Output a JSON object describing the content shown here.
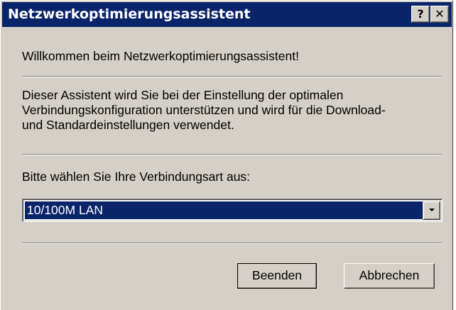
{
  "window": {
    "title": "Netzwerkoptimierungsassistent",
    "help_label": "?",
    "close_label": "✕"
  },
  "content": {
    "welcome": "Willkommen beim Netzwerkoptimierungsassistent!",
    "description_lines": [
      "Dieser Assistent wird Sie bei der Einstellung der optimalen",
      "Verbindungskonfiguration unterstützen und wird für die Download-",
      "und Standardeinstellungen verwendet."
    ],
    "prompt": "Bitte wählen Sie Ihre Verbindungsart aus:"
  },
  "connection_select": {
    "selected": "10/100M LAN",
    "arrow_icon": "chevron-down-icon"
  },
  "buttons": {
    "finish": "Beenden",
    "cancel": "Abbrechen"
  },
  "colors": {
    "titlebar": "#0a246a",
    "dialog_bg": "#d4d0c8",
    "selection": "#0a246a"
  }
}
